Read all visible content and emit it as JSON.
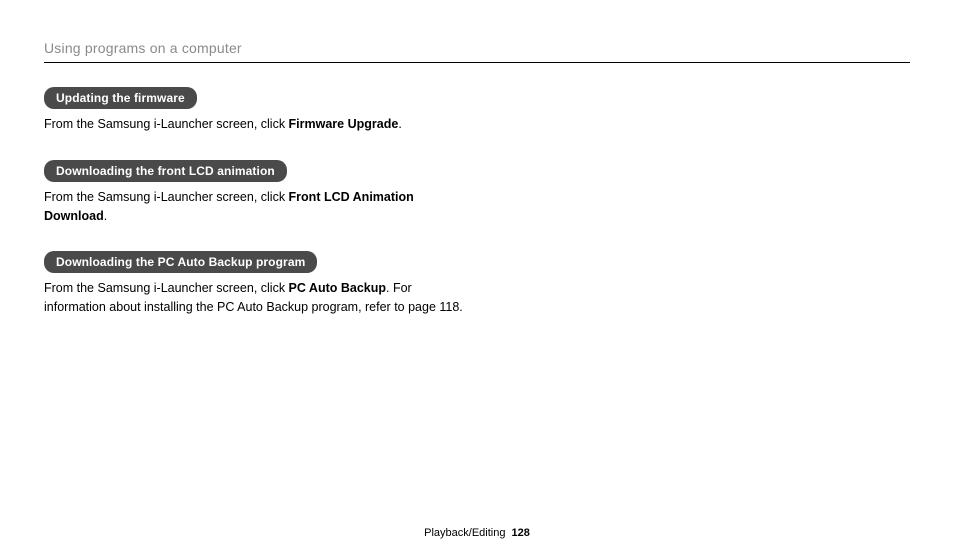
{
  "header": {
    "title": "Using programs on a computer"
  },
  "sections": [
    {
      "pill": "Updating the firmware",
      "pre": "From the Samsung i-Launcher screen, click ",
      "bold": "Firmware Upgrade",
      "post": "."
    },
    {
      "pill": "Downloading the front LCD animation",
      "pre": "From the Samsung i-Launcher screen, click ",
      "bold": "Front LCD Animation Download",
      "post": "."
    },
    {
      "pill": "Downloading the PC Auto Backup program",
      "pre": "From the Samsung i-Launcher screen, click ",
      "bold": "PC Auto Backup",
      "post": ". For information about installing the PC Auto Backup program, refer to page 118."
    }
  ],
  "footer": {
    "section": "Playback/Editing",
    "page": "128"
  }
}
